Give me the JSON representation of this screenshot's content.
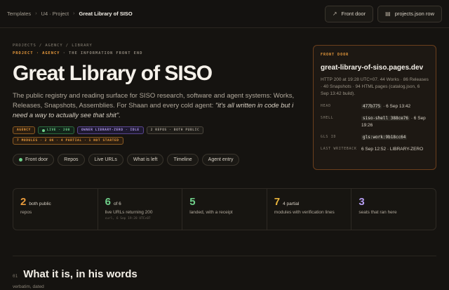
{
  "breadcrumb": {
    "items": [
      "Templates",
      "U4 · Project",
      "Great Library of SISO"
    ]
  },
  "top_actions": [
    {
      "label": "Front door",
      "icon": "external-link-icon"
    },
    {
      "label": "projects.json row",
      "icon": "file-icon"
    }
  ],
  "hero": {
    "path": "PROJECTS / AGENCY / LIBRARY",
    "tag_project": "PROJECT · AGENCY",
    "tag_rest": " · THE INFORMATION FRONT END",
    "title": "Great Library of SISO",
    "desc_main": "The public registry and reading surface for SISO research, software and agent systems: Works, Releases, Snapshots, Assemblies. For Shaan and every cold agent: ",
    "desc_quote": "\"it's all written in code but i need a way to actually see that shit\".",
    "pills": [
      {
        "label": "AGENCY",
        "tone": "orange"
      },
      {
        "label": "LIVE · 200",
        "tone": "green"
      },
      {
        "label": "OWNER LIBRARY-ZERO · IDLE",
        "tone": "purple"
      },
      {
        "label": "2 REPOS · BOTH PUBLIC",
        "tone": "gray"
      },
      {
        "label": "7 MODULES · 2 OK · 4 PARTIAL · 1 NOT STARTED",
        "tone": "orange"
      }
    ],
    "nav": [
      "Front door",
      "Repos",
      "Live URLs",
      "What is left",
      "Timeline",
      "Agent entry"
    ]
  },
  "front_door": {
    "label": "FRONT DOOR",
    "url": "great-library-of-siso.pages.dev",
    "meta": "HTTP 200 at 19:28 UTC+07. 44 Works · 86 Releases · 40 Snapshots · 94 HTML pages (catalog.json, 6 Sep 13:42 build).",
    "rows": {
      "head_k": "HEAD",
      "head_code": "477b775",
      "head_rest": " · 6 Sep 13:42",
      "shell_k": "SHELL",
      "shell_code": "siso-shell 388ce76",
      "shell_rest": " · 6 Sep 19:26",
      "gls_k": "GLS ID",
      "gls_code": "gls:work:9b18cc64",
      "last_k": "LAST WRITEBACK",
      "last_v": "6 Sep 12:52 · LIBRARY-ZERO"
    }
  },
  "stats": [
    {
      "num": "2",
      "suffix": "both public",
      "label": "repos",
      "sub": "",
      "color": "#e89a3c"
    },
    {
      "num": "6",
      "suffix": "of 6",
      "label": "live URLs returning 200",
      "sub": "curl, 6 Sep 19:28 UTC+07",
      "color": "#6fd08a"
    },
    {
      "num": "5",
      "suffix": "",
      "label": "landed, with a receipt",
      "sub": "",
      "color": "#6fd08a"
    },
    {
      "num": "7",
      "suffix": "4 partial",
      "label": "modules with verification lines",
      "sub": "",
      "color": "#e8b43c"
    },
    {
      "num": "3",
      "suffix": "",
      "label": "seats that ran here",
      "sub": "",
      "color": "#b49cf0"
    }
  ],
  "section": {
    "num": "01",
    "title": "What it is, in his words",
    "sub": "verbatim, dated"
  }
}
